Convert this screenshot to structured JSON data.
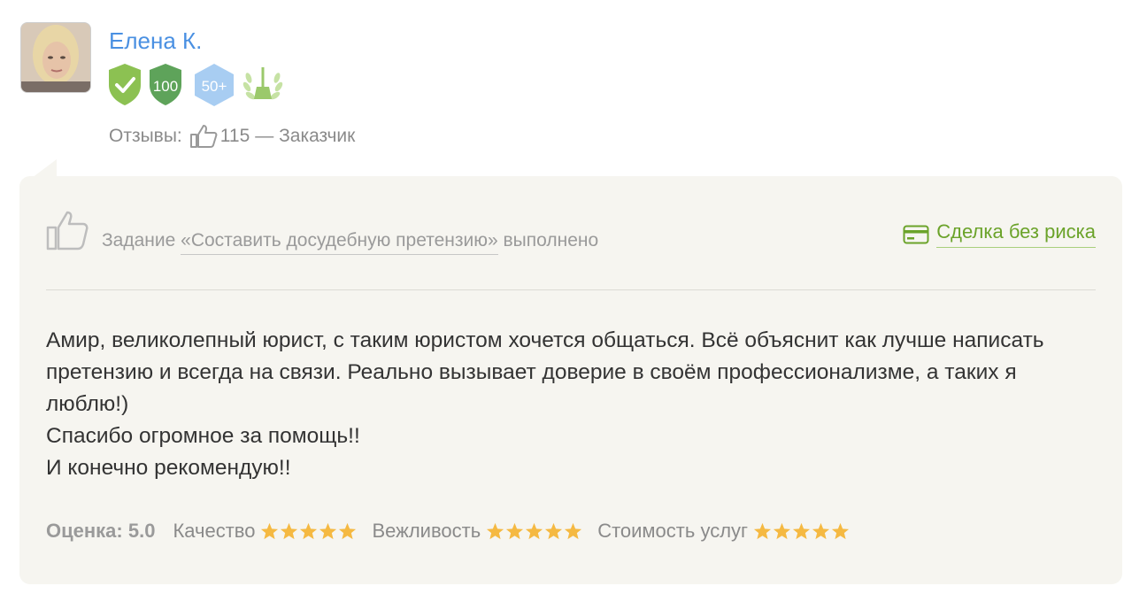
{
  "author": {
    "name": "Елена К.",
    "badges": [
      {
        "icon": "verified-shield-icon",
        "text": ""
      },
      {
        "icon": "shield-100-icon",
        "text": "100"
      },
      {
        "icon": "hexagon-50-icon",
        "text": "50+"
      },
      {
        "icon": "laurel-broom-icon",
        "text": ""
      }
    ],
    "reviews_label": "Отзывы:",
    "reviews_count": "115",
    "role": "— Заказчик"
  },
  "review": {
    "task_prefix": "Задание",
    "task_title": "«Составить досудебную претензию»",
    "task_status": "выполнено",
    "safe_deal_label": "Сделка без риска",
    "text_lines": [
      "Амир, великолепный юрист, с таким юристом хочется общаться. Всё объяснит как лучше написать претензию и всегда на связи. Реально вызывает доверие в своём профессионализме, а таких я люблю!)",
      "Спасибо огромное за помощь!!",
      "И конечно рекомендую!!"
    ],
    "overall_label": "Оценка: 5.0",
    "categories": [
      {
        "label": "Качество",
        "stars": 5
      },
      {
        "label": "Вежливость",
        "stars": 5
      },
      {
        "label": "Стоимость услуг",
        "stars": 5
      }
    ]
  },
  "colors": {
    "link_blue": "#4a90e2",
    "safe_green": "#6ba32a",
    "star": "#f5b942",
    "card_bg": "#f6f5f0"
  }
}
